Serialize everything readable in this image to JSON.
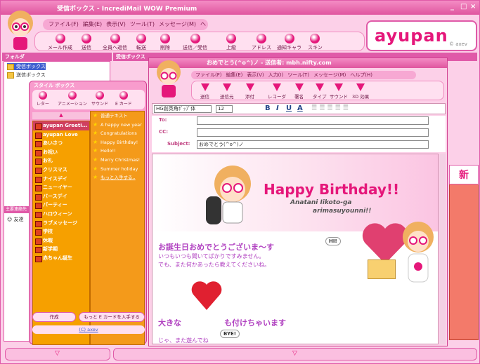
{
  "window": {
    "title": "受信ボックス - IncrediMail WOW Premium",
    "min": "_",
    "max": "□",
    "close": "×"
  },
  "menu": [
    "ファイル(F)",
    "編集(E)",
    "表示(V)",
    "ツール(T)",
    "メッセージ(M)",
    "ヘルプ(H)"
  ],
  "toolbar": [
    "メール作成",
    "送信",
    "全員へ返信",
    "転送",
    "削除",
    "送信／受信",
    "上級",
    "アドレス",
    "通知キャラ",
    "スキン"
  ],
  "logo": {
    "text": "ayupan",
    "sub": "© axev"
  },
  "folders": {
    "header": "フォルダ",
    "items": [
      "受信ボックス",
      "送信ボックス"
    ]
  },
  "inbox": {
    "header": "受信ボックス"
  },
  "stylebox": {
    "header": "スタイル ボックス",
    "tabs": [
      "レター",
      "アニメーション",
      "サウンド",
      "E カード"
    ],
    "list": [
      "ayupan Greeti...",
      "ayupan Love",
      "あいさつ",
      "お祝い",
      "お礼",
      "クリスマス",
      "ナイスデイ",
      "ニューイヤー",
      "バースデイ",
      "パーティー",
      "ハロウィーン",
      "ラブメッセージ",
      "学校",
      "休暇",
      "新学期",
      "赤ちゃん誕生"
    ],
    "list2": [
      "普通テキスト",
      "A happy new year",
      "Congratulations",
      "Happy Birthday!",
      "Hello!!",
      "Merry Christmas!",
      "Summer holiday",
      "もっと入手する.."
    ],
    "btn_create": "作成",
    "btn_more": "もっと E カードを入手する",
    "footer": "(C) axev"
  },
  "side": {
    "label": "主要連絡先",
    "contact": "友達"
  },
  "message": {
    "title": "おめでとう(^o^)ノ - 送信者: mbh.nifty.com",
    "menu": [
      "ファイル(F)",
      "編集(E)",
      "表示(V)",
      "入力(I)",
      "ツール(T)",
      "メッセージ(M)",
      "ヘルプ(H)"
    ],
    "tools": [
      "送信",
      "送信元",
      "添付",
      "レコーダ",
      "署名",
      "タイプ",
      "サウンド",
      "3D 効果"
    ],
    "font": "HG創英角ﾎﾟｯﾌﾟ体",
    "size": "12",
    "to_label": "To:",
    "cc_label": "CC:",
    "subject_label": "Subject:",
    "subject": "おめでとう(^o^)ノ",
    "hb": "Happy Birthday!!",
    "sub1": "Anatani Iikoto-ga",
    "sub2": "arimasuyounni!!",
    "greet": "お誕生日おめでとうございま〜す",
    "line1": "いつもいつも聞いてばかりですみません。",
    "line2": "でも、また何かあったら教えてくださいね。",
    "hi": "HI!",
    "big": "大きな",
    "big2": "も付けちゃいます",
    "bye": "BYE!",
    "tail": "じゃ、また遊んでね"
  },
  "new_label": "新"
}
